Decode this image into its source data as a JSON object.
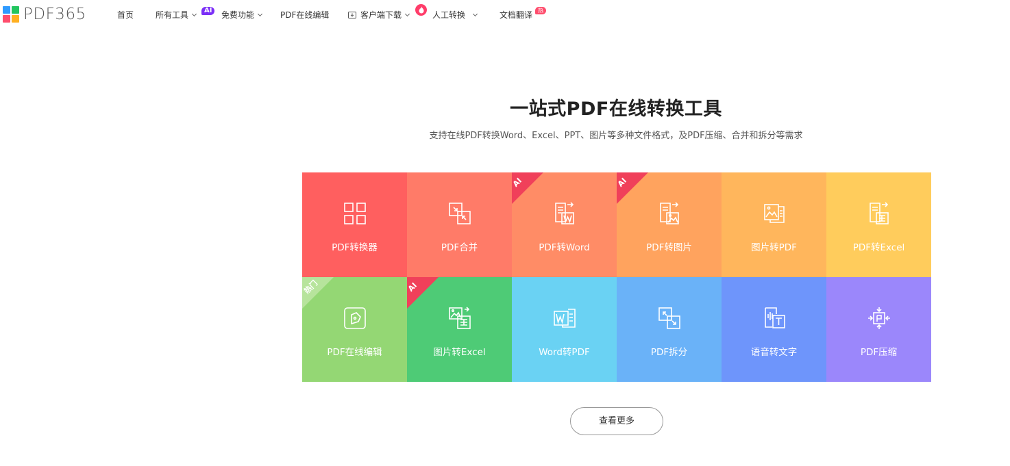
{
  "logo": {
    "text": "PDF365",
    "colors": [
      "#2f9bff",
      "#22c55e",
      "#ff4d6d",
      "#ffb020"
    ]
  },
  "nav": {
    "items": [
      {
        "label": "首页"
      },
      {
        "label": "所有工具",
        "badge": "AI"
      },
      {
        "label": "免费功能"
      },
      {
        "label": "PDF在线编辑"
      },
      {
        "label": "客户端下载"
      },
      {
        "label": "人工转换"
      },
      {
        "label": "文档翻译",
        "badge": "热门"
      }
    ]
  },
  "hero": {
    "title": "一站式PDF在线转换工具",
    "subtitle": "支持在线PDF转换Word、Excel、PPT、图片等多种文件格式，及PDF压缩、合并和拆分等需求"
  },
  "tiles": [
    {
      "label": "PDF转换器",
      "icon": "grid-icon",
      "color": "#ff5f5f"
    },
    {
      "label": "PDF合并",
      "icon": "merge-icon",
      "color": "#ff7b68"
    },
    {
      "label": "PDF转Word",
      "icon": "pdf-to-word-icon",
      "color": "#ff8c66",
      "corner": "AI",
      "corner_color": "#f0405a"
    },
    {
      "label": "PDF转图片",
      "icon": "pdf-to-image-icon",
      "color": "#ffa35e",
      "corner": "AI",
      "corner_color": "#f0405a"
    },
    {
      "label": "图片转PDF",
      "icon": "image-to-pdf-icon",
      "color": "#ffb65c"
    },
    {
      "label": "PDF转Excel",
      "icon": "pdf-to-excel-icon",
      "color": "#ffcc5c"
    },
    {
      "label": "PDF在线编辑",
      "icon": "edit-icon",
      "color": "#94d774",
      "corner": "热门",
      "corner_color": "#b7e49c"
    },
    {
      "label": "图片转Excel",
      "icon": "image-to-excel-icon",
      "color": "#4ecb76",
      "corner": "AI",
      "corner_color": "#f0405a"
    },
    {
      "label": "Word转PDF",
      "icon": "word-to-pdf-icon",
      "color": "#6ad2f3"
    },
    {
      "label": "PDF拆分",
      "icon": "split-icon",
      "color": "#6ab2f8"
    },
    {
      "label": "语音转文字",
      "icon": "speech-to-text-icon",
      "color": "#6e95fb"
    },
    {
      "label": "PDF压缩",
      "icon": "compress-icon",
      "color": "#9b87fb"
    }
  ],
  "more_button": "查看更多"
}
